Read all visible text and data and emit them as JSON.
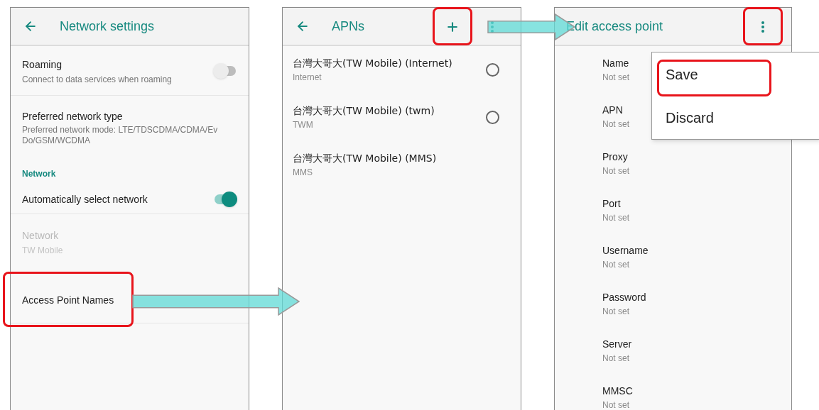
{
  "network_settings": {
    "title": "Network settings",
    "back": true,
    "items": [
      {
        "kind": "switch",
        "title": "Roaming",
        "summary": "Connect to data services when roaming",
        "on": false,
        "disabled": false,
        "highlighted": false
      },
      {
        "kind": "text",
        "title": "Preferred network type",
        "summary": "Preferred network mode: LTE/TDSCDMA/CDMA/EvDo/GSM/WCDMA",
        "disabled": false,
        "highlighted": false
      },
      {
        "kind": "category",
        "title": "Network"
      },
      {
        "kind": "switch",
        "title": "Automatically select network",
        "on": true,
        "disabled": false,
        "highlighted": false
      },
      {
        "kind": "text",
        "title": "Network",
        "summary": "TW Mobile",
        "disabled": true,
        "highlighted": false
      },
      {
        "kind": "text",
        "title": "Access Point Names",
        "disabled": false,
        "highlighted": true
      }
    ]
  },
  "apns": {
    "title": "APNs",
    "back": true,
    "actions": [
      {
        "kind": "add",
        "highlighted": true
      },
      {
        "kind": "more",
        "highlighted": false
      }
    ],
    "items": [
      {
        "name": "台灣大哥大(TW Mobile) (Internet)",
        "apn": "Internet",
        "selectable": true,
        "selected": false
      },
      {
        "name": "台灣大哥大(TW Mobile) (twm)",
        "apn": "TWM",
        "selectable": true,
        "selected": false
      },
      {
        "name": "台灣大哥大(TW Mobile) (MMS)",
        "apn": "MMS",
        "selectable": false,
        "selected": false
      }
    ]
  },
  "edit_access_point": {
    "title": "Edit access point",
    "back": false,
    "actions": [
      {
        "kind": "more",
        "highlighted": true
      }
    ],
    "fields": [
      {
        "label": "Name",
        "value": "Not set"
      },
      {
        "label": "APN",
        "value": "Not set"
      },
      {
        "label": "Proxy",
        "value": "Not set"
      },
      {
        "label": "Port",
        "value": "Not set"
      },
      {
        "label": "Username",
        "value": "Not set"
      },
      {
        "label": "Password",
        "value": "Not set"
      },
      {
        "label": "Server",
        "value": "Not set"
      },
      {
        "label": "MMSC",
        "value": "Not set"
      }
    ]
  },
  "overflow_menu": {
    "items": [
      {
        "label": "Save",
        "highlighted": true
      },
      {
        "label": "Discard",
        "highlighted": false
      }
    ]
  }
}
